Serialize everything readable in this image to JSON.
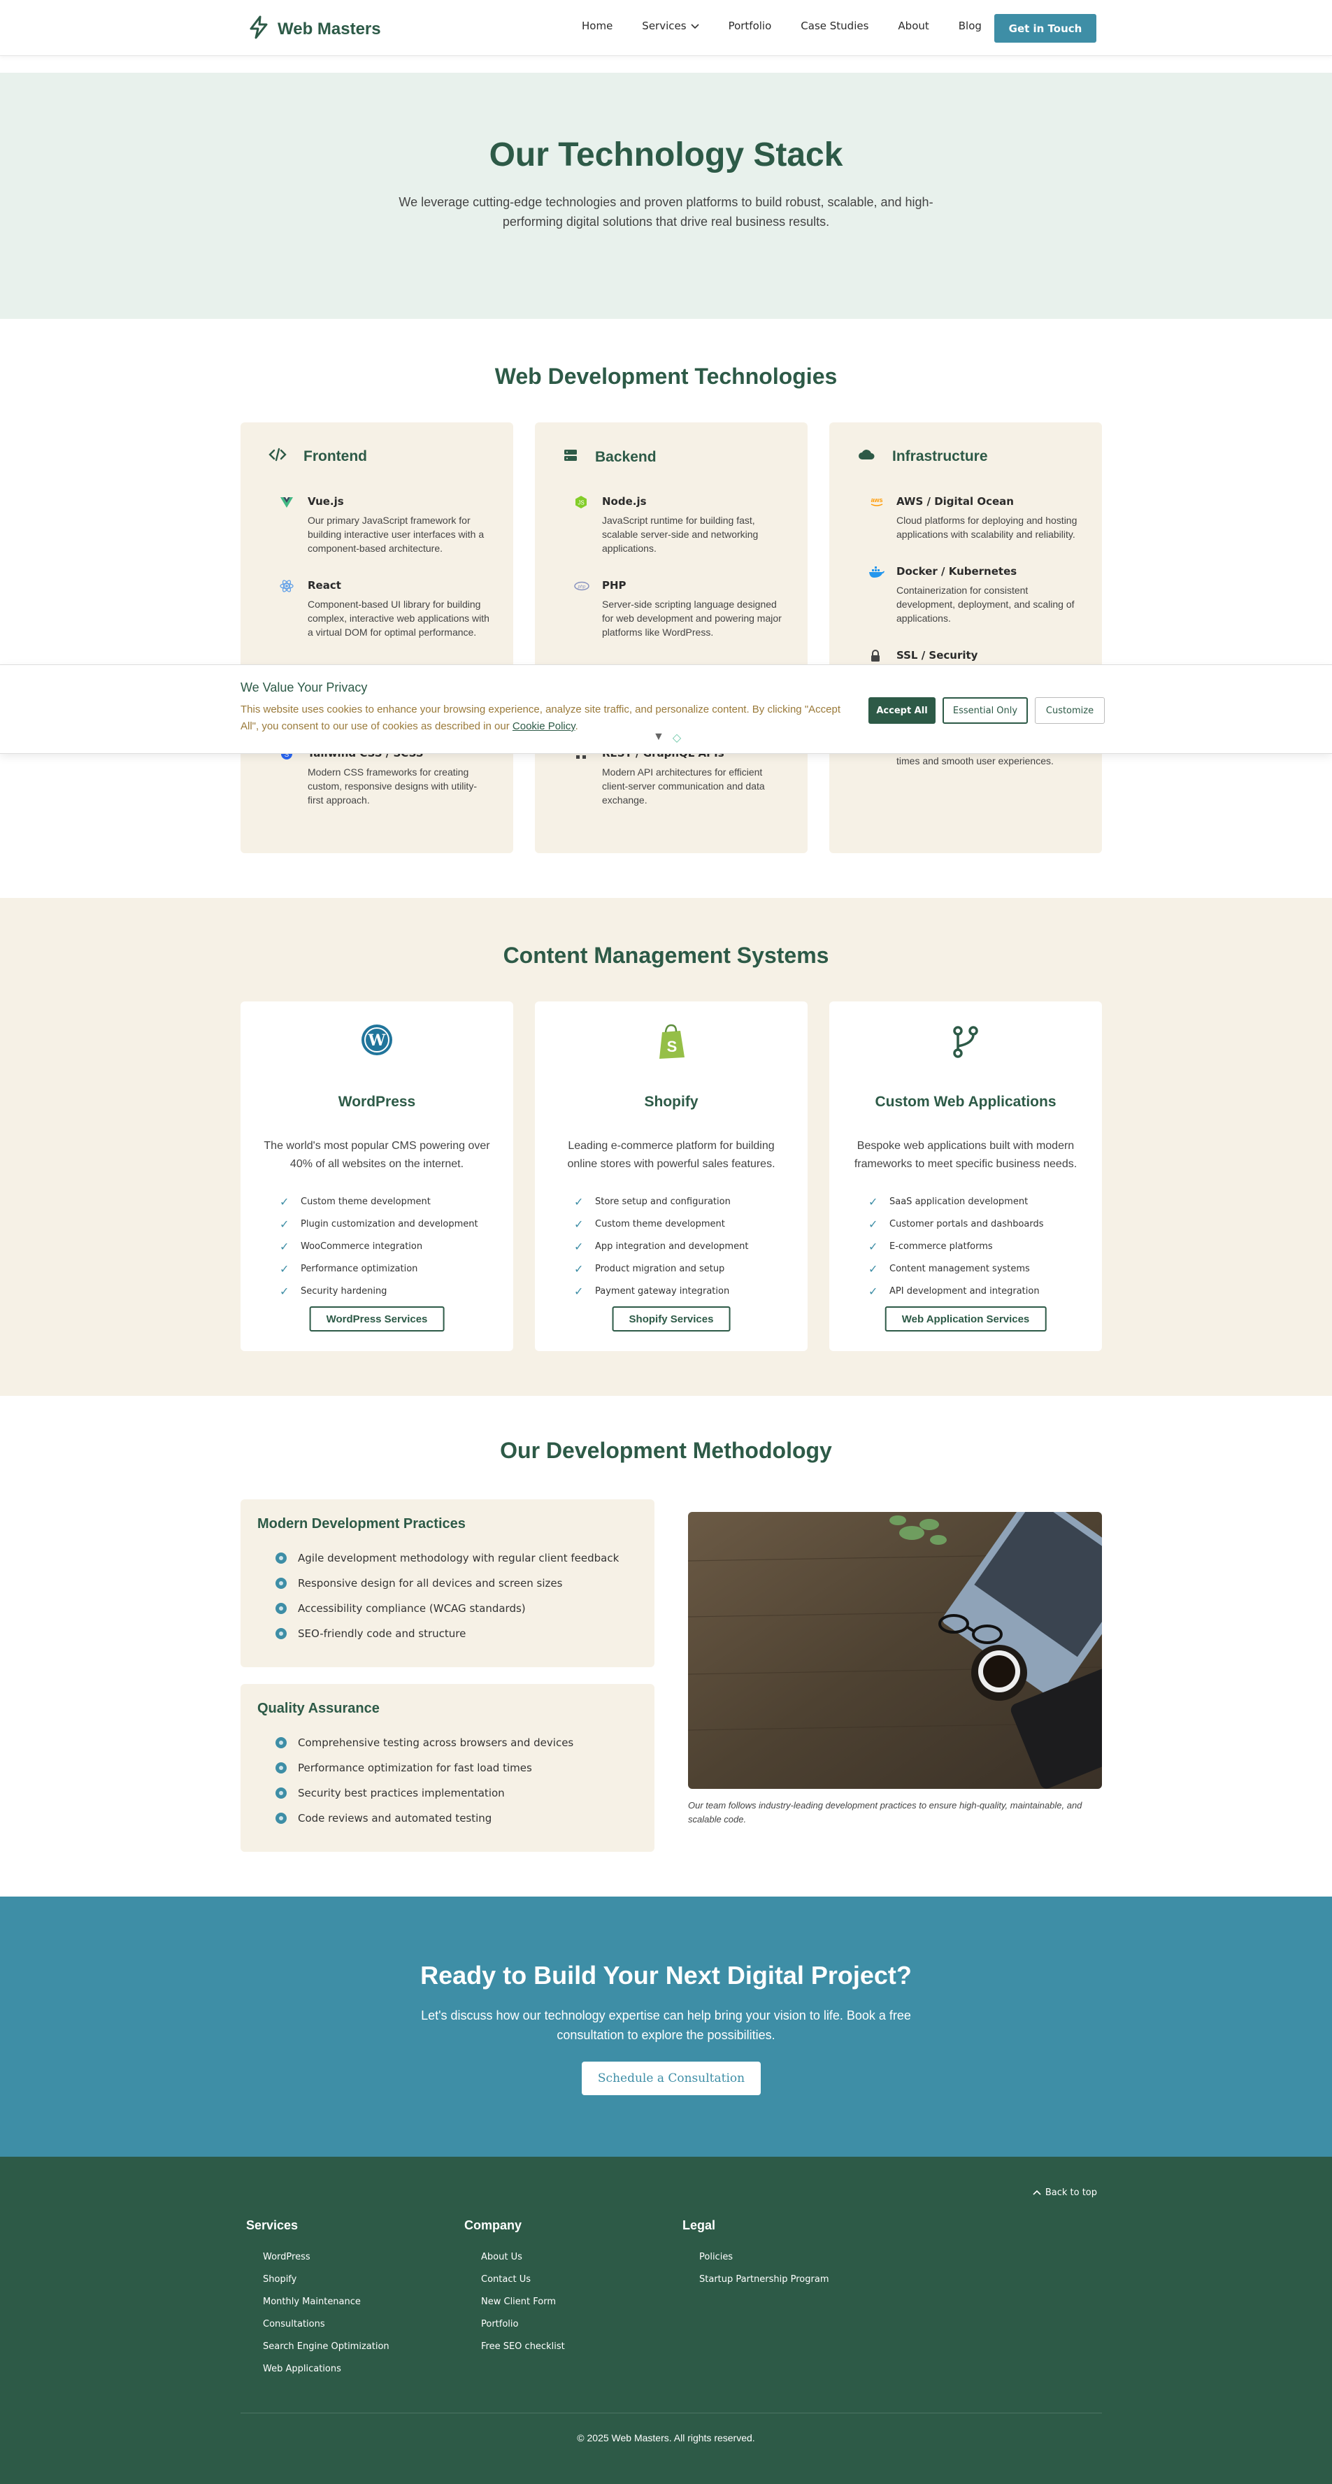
{
  "nav": {
    "brand": "Web Masters",
    "links": [
      "Home",
      "Services",
      "Portfolio",
      "Case Studies",
      "About",
      "Blog"
    ],
    "cta": "Get in Touch"
  },
  "hero": {
    "title": "Our Technology Stack",
    "subtitle": "We leverage cutting-edge technologies and proven platforms to build robust, scalable, and high-performing digital solutions that drive real business results."
  },
  "webdev": {
    "title": "Web Development Technologies",
    "cards": [
      {
        "title": "Frontend",
        "icon": "code-icon",
        "items": [
          {
            "name": "Vue.js",
            "icon": "vue-icon",
            "desc": "Our primary JavaScript framework for building interactive user interfaces with a component-based architecture."
          },
          {
            "name": "React",
            "icon": "react-icon",
            "desc": "Component-based UI library for building complex, interactive web applications with a virtual DOM for optimal performance."
          },
          {
            "name": "Tailwind CSS / SCSS",
            "icon": "css-icon",
            "desc": "Modern CSS frameworks for creating custom, responsive designs with utility-first approach."
          }
        ]
      },
      {
        "title": "Backend",
        "icon": "server-icon",
        "items": [
          {
            "name": "Node.js",
            "icon": "nodejs-icon",
            "desc": "JavaScript runtime for building fast, scalable server-side and networking applications."
          },
          {
            "name": "PHP",
            "icon": "php-icon",
            "desc": "Server-side scripting language designed for web development and powering major platforms like WordPress."
          },
          {
            "name": "REST / GraphQL APIs",
            "icon": "api-icon",
            "desc": "Modern API architectures for efficient client-server communication and data exchange."
          }
        ]
      },
      {
        "title": "Infrastructure",
        "icon": "cloud-icon",
        "items": [
          {
            "name": "AWS / Digital Ocean",
            "icon": "aws-icon",
            "desc": "Cloud platforms for deploying and hosting applications with scalability and reliability."
          },
          {
            "name": "Docker / Kubernetes",
            "icon": "docker-icon",
            "desc": "Containerization for consistent development, deployment, and scaling of applications."
          },
          {
            "name": "SSL / Security",
            "icon": "lock-icon",
            "desc": "times and smooth user experiences."
          }
        ]
      }
    ]
  },
  "cookie": {
    "title": "We Value Your Privacy",
    "text": "This website uses cookies to enhance your browsing experience, analyze site traffic, and personalize content. By clicking \"Accept All\", you consent to our use of cookies as described in our",
    "link": "Cookie Policy",
    "link_suffix": ".",
    "accept": "Accept All",
    "essential": "Essential Only",
    "customize": "Customize"
  },
  "cms": {
    "title": "Content Management Systems",
    "cards": [
      {
        "name": "WordPress",
        "icon": "wordpress-icon",
        "desc": "The world's most popular CMS powering over 40% of all websites on the internet.",
        "features": [
          "Custom theme development",
          "Plugin customization and development",
          "WooCommerce integration",
          "Performance optimization",
          "Security hardening"
        ],
        "button": "WordPress Services"
      },
      {
        "name": "Shopify",
        "icon": "shopify-icon",
        "desc": "Leading e-commerce platform for building online stores with powerful sales features.",
        "features": [
          "Store setup and configuration",
          "Custom theme development",
          "App integration and development",
          "Product migration and setup",
          "Payment gateway integration"
        ],
        "button": "Shopify Services"
      },
      {
        "name": "Custom Web Applications",
        "icon": "git-branch-icon",
        "desc": "Bespoke web applications built with modern frameworks to meet specific business needs.",
        "features": [
          "SaaS application development",
          "Customer portals and dashboards",
          "E-commerce platforms",
          "Content management systems",
          "API development and integration"
        ],
        "button": "Web Application Services"
      }
    ]
  },
  "methodology": {
    "title": "Our Development Methodology",
    "practices": {
      "title": "Modern Development Practices",
      "items": [
        "Agile development methodology with regular client feedback",
        "Responsive design for all devices and screen sizes",
        "Accessibility compliance (WCAG standards)",
        "SEO-friendly code and structure"
      ]
    },
    "qa": {
      "title": "Quality Assurance",
      "items": [
        "Comprehensive testing across browsers and devices",
        "Performance optimization for fast load times",
        "Security best practices implementation",
        "Code reviews and automated testing"
      ]
    },
    "caption": "Our team follows industry-leading development practices to ensure high-quality, maintainable, and scalable code."
  },
  "cta": {
    "title": "Ready to Build Your Next Digital Project?",
    "text": "Let's discuss how our technology expertise can help bring your vision to life. Book a free consultation to explore the possibilities.",
    "button": "Schedule a Consultation"
  },
  "footer": {
    "back_to_top": "Back to top",
    "columns": [
      {
        "title": "Services",
        "links": [
          "WordPress",
          "Shopify",
          "Monthly Maintenance",
          "Consultations",
          "Search Engine Optimization",
          "Web Applications"
        ]
      },
      {
        "title": "Company",
        "links": [
          "About Us",
          "Contact Us",
          "New Client Form",
          "Portfolio",
          "Free SEO checklist"
        ]
      },
      {
        "title": "Legal",
        "links": [
          "Policies",
          "Startup Partnership Program"
        ]
      }
    ],
    "copyright": "© 2025 Web Masters. All rights reserved."
  },
  "colors": {
    "primary": "#2d5a47",
    "accent": "#3e8ea6",
    "cream": "#f6f1e6",
    "mint": "#e8f1ec"
  }
}
